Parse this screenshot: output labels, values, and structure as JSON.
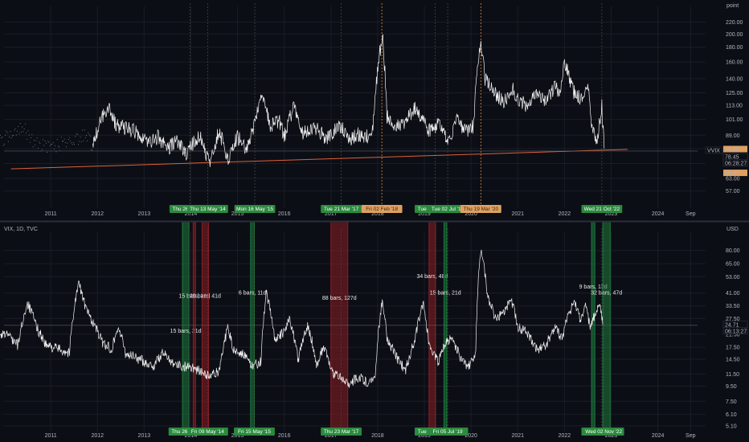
{
  "colors": {
    "background": "#0c0e15",
    "price_line": "#f2f2f2",
    "trendline": "#e0603a",
    "green_zone": "#1e7a3c",
    "red_zone": "#8c1d25",
    "green_tag": "#2b8a3e",
    "orange_tag": "#e0a060",
    "orange_line": "#e08a3a",
    "grid": "#1a1d27",
    "separator": "#2a2e39"
  },
  "chart_data": [
    {
      "type": "line",
      "series": [
        {
          "values": [
            [
              2009.9,
              84
            ],
            [
              2010.2,
              90
            ],
            [
              2010.4,
              97
            ],
            [
              2010.6,
              86
            ],
            [
              2010.9,
              80
            ],
            [
              2011.4,
              84
            ],
            [
              2011.7,
              90
            ],
            [
              2011.9,
              82
            ],
            [
              2012.15,
              108
            ],
            [
              2012.25,
              112
            ],
            [
              2012.4,
              96
            ],
            [
              2012.6,
              95
            ],
            [
              2012.9,
              90
            ],
            [
              2013.1,
              84
            ],
            [
              2013.3,
              88
            ],
            [
              2013.5,
              80
            ],
            [
              2013.7,
              86
            ],
            [
              2013.9,
              76
            ],
            [
              2014.0,
              82
            ],
            [
              2014.2,
              88
            ],
            [
              2014.4,
              70
            ],
            [
              2014.6,
              92
            ],
            [
              2014.8,
              74
            ],
            [
              2015.0,
              88
            ],
            [
              2015.2,
              80
            ],
            [
              2015.4,
              100
            ],
            [
              2015.5,
              126
            ],
            [
              2015.7,
              96
            ],
            [
              2015.9,
              100
            ],
            [
              2016.0,
              88
            ],
            [
              2016.2,
              112
            ],
            [
              2016.4,
              90
            ],
            [
              2016.5,
              92
            ],
            [
              2016.7,
              94
            ],
            [
              2016.9,
              86
            ],
            [
              2017.0,
              90
            ],
            [
              2017.2,
              96
            ],
            [
              2017.4,
              86
            ],
            [
              2017.6,
              90
            ],
            [
              2017.8,
              88
            ],
            [
              2017.9,
              96
            ],
            [
              2018.1,
              200
            ],
            [
              2018.2,
              104
            ],
            [
              2018.4,
              96
            ],
            [
              2018.6,
              100
            ],
            [
              2018.8,
              110
            ],
            [
              2018.95,
              102
            ],
            [
              2019.1,
              92
            ],
            [
              2019.3,
              98
            ],
            [
              2019.5,
              84
            ],
            [
              2019.7,
              100
            ],
            [
              2019.9,
              92
            ],
            [
              2020.05,
              96
            ],
            [
              2020.2,
              188
            ],
            [
              2020.3,
              140
            ],
            [
              2020.5,
              124
            ],
            [
              2020.7,
              118
            ],
            [
              2020.9,
              128
            ],
            [
              2021.0,
              120
            ],
            [
              2021.2,
              112
            ],
            [
              2021.4,
              122
            ],
            [
              2021.6,
              116
            ],
            [
              2021.8,
              132
            ],
            [
              2021.9,
              124
            ],
            [
              2022.0,
              160
            ],
            [
              2022.2,
              126
            ],
            [
              2022.4,
              118
            ],
            [
              2022.5,
              130
            ],
            [
              2022.6,
              92
            ],
            [
              2022.7,
              84
            ],
            [
              2022.8,
              112
            ],
            [
              2022.85,
              80
            ]
          ]
        }
      ],
      "ylabel": "point",
      "y_scale": "log",
      "ylim": [
        50,
        240
      ],
      "xlim": [
        2010.0,
        2024.85
      ],
      "y_ticks": [
        "220.00",
        "200.00",
        "180.00",
        "160.00",
        "140.00",
        "125.00",
        "113.00",
        "101.00",
        "89.00",
        "80.00",
        "71.00",
        "63.00",
        "57.00"
      ],
      "x_ticks": [
        "2011",
        "2012",
        "2013",
        "2014",
        "2015",
        "2016",
        "2017",
        "2018",
        "2019",
        "2020",
        "2021",
        "2022",
        "2023",
        "2024",
        "Sep"
      ],
      "trendline": {
        "from": [
          2010.15,
          68
        ],
        "to": [
          2023.35,
          79.5
        ]
      },
      "last_value_labels": [
        {
          "label": "79.20",
          "y": 79.2,
          "color": "#e0a060"
        },
        {
          "label": "VVIX",
          "y": 78.45,
          "color": "#ffffff"
        },
        {
          "label": "78.45",
          "y": 78.45,
          "color": "#ffffff"
        },
        {
          "label": "06:28:27",
          "y": 78.45,
          "color": "#ffffff"
        },
        {
          "label": "65.47",
          "y": 65.47,
          "color": "#e0a060"
        }
      ],
      "date_markers": [
        {
          "label": "Thu 26 Dec '13",
          "x": 2013.98,
          "color": "green"
        },
        {
          "label": "Thu 13 May '14",
          "x": 2014.36,
          "color": "green"
        },
        {
          "label": "Mon 16 May '15",
          "x": 2015.37,
          "color": "green"
        },
        {
          "label": "Tue 21 Mar '17",
          "x": 2017.22,
          "color": "green"
        },
        {
          "label": "Fri 02 Feb '18",
          "x": 2018.09,
          "color": "orange"
        },
        {
          "label": "Tue 26 Mar '19",
          "x": 2019.23,
          "color": "green"
        },
        {
          "label": "Tue 02 Jul '19",
          "x": 2019.5,
          "color": "green"
        },
        {
          "label": "Thu 19 Mar '20",
          "x": 2020.21,
          "color": "orange"
        },
        {
          "label": "Wed 21 Oct '22",
          "x": 2022.8,
          "color": "green"
        }
      ]
    },
    {
      "type": "line",
      "title": "VIX, 1D, TVC",
      "series": [
        {
          "name": "VIX",
          "values": [
            [
              2009.6,
              22
            ],
            [
              2009.7,
              34
            ],
            [
              2009.8,
              26
            ],
            [
              2009.9,
              20
            ],
            [
              2010.05,
              22
            ],
            [
              2010.3,
              18
            ],
            [
              2010.5,
              35
            ],
            [
              2010.7,
              24
            ],
            [
              2010.9,
              18
            ],
            [
              2011.2,
              17
            ],
            [
              2011.4,
              16
            ],
            [
              2011.6,
              48
            ],
            [
              2011.75,
              32
            ],
            [
              2011.9,
              26
            ],
            [
              2012.1,
              19
            ],
            [
              2012.3,
              17
            ],
            [
              2012.45,
              24
            ],
            [
              2012.6,
              16
            ],
            [
              2012.8,
              15
            ],
            [
              2013.0,
              14
            ],
            [
              2013.2,
              13
            ],
            [
              2013.4,
              16
            ],
            [
              2013.6,
              14
            ],
            [
              2013.8,
              13
            ],
            [
              2014.0,
              13
            ],
            [
              2014.2,
              12
            ],
            [
              2014.4,
              11
            ],
            [
              2014.6,
              12
            ],
            [
              2014.8,
              24
            ],
            [
              2014.9,
              17
            ],
            [
              2015.1,
              16
            ],
            [
              2015.3,
              13
            ],
            [
              2015.5,
              14
            ],
            [
              2015.62,
              40
            ],
            [
              2015.8,
              20
            ],
            [
              2016.0,
              22
            ],
            [
              2016.1,
              28
            ],
            [
              2016.3,
              14
            ],
            [
              2016.5,
              25
            ],
            [
              2016.7,
              13
            ],
            [
              2016.85,
              18
            ],
            [
              2017.0,
              12
            ],
            [
              2017.2,
              11
            ],
            [
              2017.4,
              10
            ],
            [
              2017.6,
              11
            ],
            [
              2017.8,
              10
            ],
            [
              2017.95,
              11
            ],
            [
              2018.1,
              37
            ],
            [
              2018.2,
              20
            ],
            [
              2018.4,
              15
            ],
            [
              2018.6,
              12
            ],
            [
              2018.8,
              20
            ],
            [
              2018.97,
              35
            ],
            [
              2019.1,
              18
            ],
            [
              2019.3,
              14
            ],
            [
              2019.45,
              19
            ],
            [
              2019.6,
              20
            ],
            [
              2019.8,
              14
            ],
            [
              2019.95,
              13
            ],
            [
              2020.1,
              16
            ],
            [
              2020.21,
              82
            ],
            [
              2020.35,
              40
            ],
            [
              2020.5,
              28
            ],
            [
              2020.7,
              30
            ],
            [
              2020.85,
              38
            ],
            [
              2021.0,
              24
            ],
            [
              2021.2,
              22
            ],
            [
              2021.4,
              17
            ],
            [
              2021.6,
              18
            ],
            [
              2021.8,
              24
            ],
            [
              2021.95,
              20
            ],
            [
              2022.1,
              30
            ],
            [
              2022.2,
              36
            ],
            [
              2022.35,
              26
            ],
            [
              2022.45,
              33
            ],
            [
              2022.55,
              24
            ],
            [
              2022.7,
              32
            ],
            [
              2022.75,
              34
            ],
            [
              2022.82,
              25
            ]
          ]
        }
      ],
      "ylabel": "USD",
      "y_scale": "log",
      "ylim": [
        4.6,
        100
      ],
      "xlim": [
        2010.0,
        2024.85
      ],
      "y_ticks": [
        "80.00",
        "65.00",
        "53.00",
        "41.00",
        "33.50",
        "27.50",
        "21.50",
        "17.50",
        "14.50",
        "11.50",
        "9.50",
        "7.50",
        "6.10",
        "5.10"
      ],
      "x_ticks": [
        "2011",
        "2012",
        "2013",
        "2014",
        "2015",
        "2016",
        "2017",
        "2018",
        "2019",
        "2020",
        "2021",
        "2022",
        "2023",
        "2024",
        "Sep"
      ],
      "last_value_labels": [
        {
          "label": "24.71",
          "y": 24.71,
          "color": "#ffffff"
        },
        {
          "label": "06:13:27",
          "y": 24.71,
          "color": "#ffffff"
        }
      ],
      "zones": [
        {
          "x1": 2013.82,
          "x2": 2013.96,
          "color": "green",
          "label": "15 bars, 21d",
          "label_y": 22
        },
        {
          "x1": 2014.05,
          "x2": 2014.1,
          "color": "red",
          "label": "15 bars, 21d",
          "label_y": 38
        },
        {
          "x1": 2014.24,
          "x2": 2014.38,
          "color": "red",
          "label": "29 bars, 41d",
          "label_y": 38
        },
        {
          "x1": 2015.28,
          "x2": 2015.36,
          "color": "green",
          "label": "6 bars, 11d",
          "label_y": 40
        },
        {
          "x1": 2017.0,
          "x2": 2017.36,
          "color": "red",
          "label": "88 bars, 127d",
          "label_y": 37
        },
        {
          "x1": 2019.1,
          "x2": 2019.24,
          "color": "red",
          "label": "34 bars, 48d",
          "label_y": 52
        },
        {
          "x1": 2019.42,
          "x2": 2019.48,
          "color": "green",
          "label": "15 bars, 21d",
          "label_y": 40
        },
        {
          "x1": 2022.58,
          "x2": 2022.65,
          "color": "green",
          "label": "9 bars, 13d",
          "label_y": 44
        },
        {
          "x1": 2022.82,
          "x2": 2022.98,
          "color": "green",
          "label": "32 bars, 47d",
          "label_y": 40
        }
      ],
      "date_markers": [
        {
          "label": "Thu 26 Dec '13",
          "x": 2013.96,
          "color": "green"
        },
        {
          "label": "Fri 09 May '14",
          "x": 2014.36,
          "color": "green"
        },
        {
          "label": "Fri 15 May '15",
          "x": 2015.36,
          "color": "green"
        },
        {
          "label": "Thu 23 Mar '17",
          "x": 2017.22,
          "color": "green"
        },
        {
          "label": "Tue 26 Mar '19",
          "x": 2019.23,
          "color": "green"
        },
        {
          "label": "Fri 05 Jul '19",
          "x": 2019.5,
          "color": "green"
        },
        {
          "label": "Wed 21 Oct '22",
          "x": 2022.8,
          "color": "green"
        },
        {
          "label": "Wed 02 Nov '22",
          "x": 2022.84,
          "color": "green"
        }
      ]
    }
  ]
}
